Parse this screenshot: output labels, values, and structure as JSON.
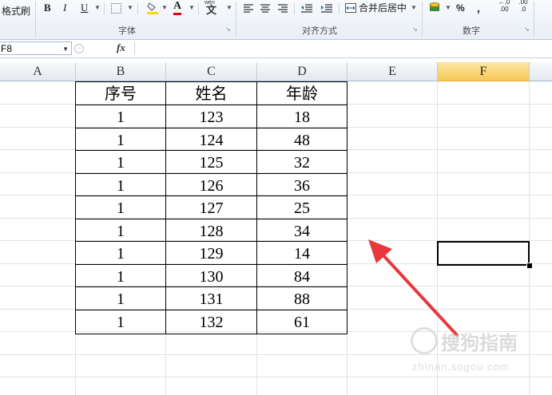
{
  "ribbon": {
    "format_painter_label": "格式刷",
    "bold": "B",
    "italic": "I",
    "underline": "U",
    "font_color_letter": "A",
    "phonetic_label": "wén",
    "phonetic_char": "文",
    "merge_center_label": "合并后居中",
    "percent": "%",
    "comma": ",",
    "inc_decimal": ".00",
    "dec_decimal": ".0",
    "group_font": "字体",
    "group_alignment": "对齐方式",
    "group_number": "数字"
  },
  "formula_bar": {
    "name_box": "F8",
    "fx": "fx",
    "formula": ""
  },
  "columns": [
    "A",
    "B",
    "C",
    "D",
    "E",
    "F"
  ],
  "selected_column": "F",
  "table": {
    "headers": [
      "序号",
      "姓名",
      "年龄"
    ],
    "rows": [
      [
        "1",
        "123",
        "18"
      ],
      [
        "1",
        "124",
        "48"
      ],
      [
        "1",
        "125",
        "32"
      ],
      [
        "1",
        "126",
        "36"
      ],
      [
        "1",
        "127",
        "25"
      ],
      [
        "1",
        "128",
        "34"
      ],
      [
        "1",
        "129",
        "14"
      ],
      [
        "1",
        "130",
        "84"
      ],
      [
        "1",
        "131",
        "88"
      ],
      [
        "1",
        "132",
        "61"
      ]
    ]
  },
  "watermark": {
    "text": "搜狗指南",
    "url": "zhinan.sogou.com"
  },
  "colors": {
    "arrow": "#e8383d",
    "selected_header": "#f6c955"
  }
}
